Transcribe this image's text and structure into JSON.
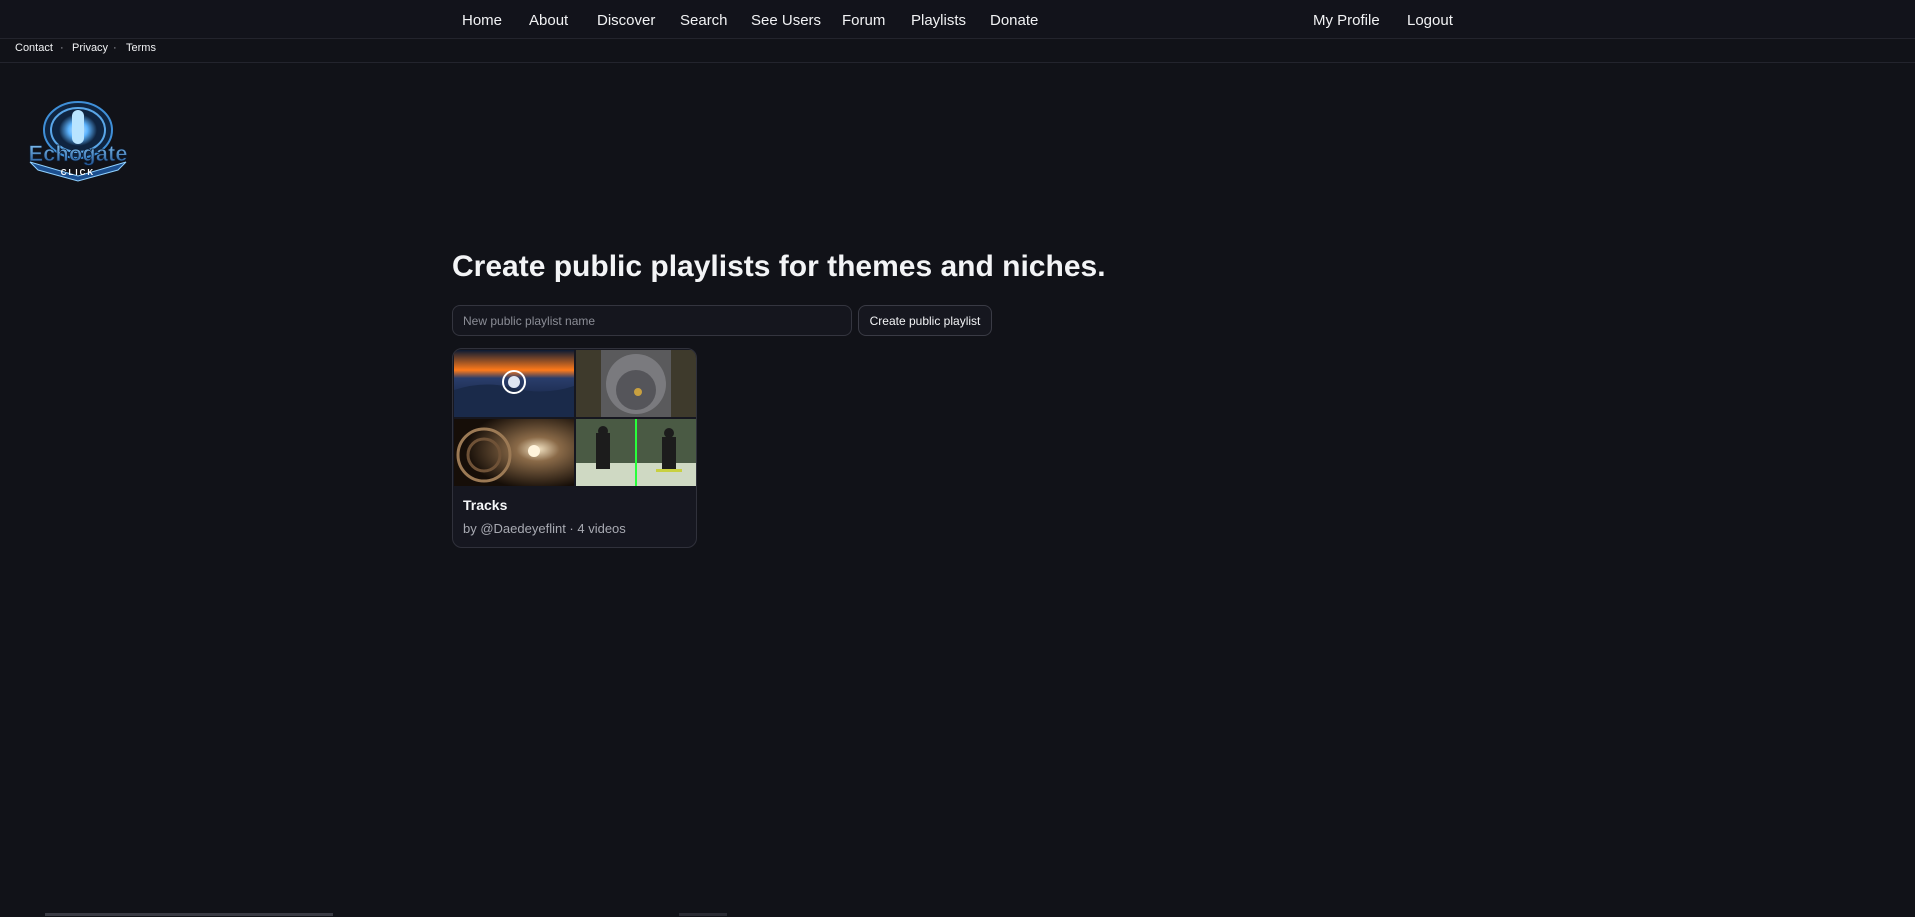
{
  "nav": {
    "items": [
      {
        "label": "Home"
      },
      {
        "label": "About"
      },
      {
        "label": "Discover"
      },
      {
        "label": "Search"
      },
      {
        "label": "See Users"
      },
      {
        "label": "Forum"
      },
      {
        "label": "Playlists"
      },
      {
        "label": "Donate"
      }
    ],
    "right": [
      {
        "label": "My Profile"
      },
      {
        "label": "Logout"
      }
    ]
  },
  "subnav": {
    "items": [
      {
        "label": "Contact"
      },
      {
        "label": "Privacy"
      },
      {
        "label": "Terms"
      }
    ],
    "separator": "·"
  },
  "logo": {
    "text": "Echogate",
    "subtext": "CLICK",
    "colors": {
      "primary": "#3f8fd8",
      "glow": "#8fd0ff",
      "dark": "#0f2440"
    }
  },
  "main": {
    "heading": "Create public playlists for themes and niches.",
    "input_placeholder": "New public playlist name",
    "create_button": "Create public playlist"
  },
  "playlists": [
    {
      "title": "Tracks",
      "meta": "by @Daedeyeflint · 4 videos",
      "thumbnails": [
        "sunset-landscape",
        "grey-creature",
        "metal-machine",
        "green-room-figures"
      ]
    }
  ],
  "colors": {
    "background": "#111218",
    "nav_background": "#12131b",
    "card_background": "#161720",
    "text": "#f1f2f4",
    "muted_text": "#a8aab2"
  }
}
